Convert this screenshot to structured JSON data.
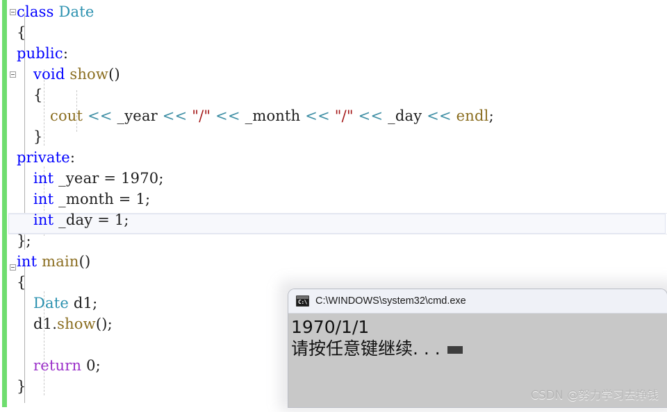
{
  "editor": {
    "language": "C++",
    "change_bar_color": "#6fdd6f",
    "current_line_index": 10,
    "theme": {
      "background": "#ffffff",
      "keyword": "#0000ff",
      "user_type": "#2b91af",
      "identifier": "#8a6d1f",
      "string": "#a31515",
      "operator": "#3f8fa5",
      "control_keyword": "#9b30c9",
      "plain_text": "#1c1c1c",
      "current_line_fill": "#f7f8fc",
      "current_line_border": "#dfe3f0"
    },
    "lines": [
      {
        "indent": 0,
        "tokens": [
          {
            "t": "class",
            "c": "kw"
          },
          {
            "t": " ",
            "c": "plain"
          },
          {
            "t": "Date",
            "c": "type"
          }
        ]
      },
      {
        "indent": 0,
        "tokens": [
          {
            "t": "{",
            "c": "plain"
          }
        ]
      },
      {
        "indent": 0,
        "tokens": [
          {
            "t": "public",
            "c": "kw"
          },
          {
            "t": ":",
            "c": "plain"
          }
        ]
      },
      {
        "indent": 1,
        "tokens": [
          {
            "t": "void",
            "c": "kw"
          },
          {
            "t": " ",
            "c": "plain"
          },
          {
            "t": "show",
            "c": "fn"
          },
          {
            "t": "()",
            "c": "plain"
          }
        ]
      },
      {
        "indent": 1,
        "tokens": [
          {
            "t": "{",
            "c": "plain"
          }
        ]
      },
      {
        "indent": 2,
        "tokens": [
          {
            "t": "cout",
            "c": "fn"
          },
          {
            "t": " ",
            "c": "plain"
          },
          {
            "t": "<<",
            "c": "op"
          },
          {
            "t": " ",
            "c": "plain"
          },
          {
            "t": "_year",
            "c": "plain"
          },
          {
            "t": " ",
            "c": "plain"
          },
          {
            "t": "<<",
            "c": "op"
          },
          {
            "t": " ",
            "c": "plain"
          },
          {
            "t": "\"/\"",
            "c": "str"
          },
          {
            "t": " ",
            "c": "plain"
          },
          {
            "t": "<<",
            "c": "op"
          },
          {
            "t": " ",
            "c": "plain"
          },
          {
            "t": "_month",
            "c": "plain"
          },
          {
            "t": " ",
            "c": "plain"
          },
          {
            "t": "<<",
            "c": "op"
          },
          {
            "t": " ",
            "c": "plain"
          },
          {
            "t": "\"/\"",
            "c": "str"
          },
          {
            "t": " ",
            "c": "plain"
          },
          {
            "t": "<<",
            "c": "op"
          },
          {
            "t": " ",
            "c": "plain"
          },
          {
            "t": "_day",
            "c": "plain"
          },
          {
            "t": " ",
            "c": "plain"
          },
          {
            "t": "<<",
            "c": "op"
          },
          {
            "t": " ",
            "c": "plain"
          },
          {
            "t": "endl",
            "c": "fn"
          },
          {
            "t": ";",
            "c": "plain"
          }
        ]
      },
      {
        "indent": 1,
        "tokens": [
          {
            "t": "}",
            "c": "plain"
          }
        ]
      },
      {
        "indent": 0,
        "tokens": [
          {
            "t": "private",
            "c": "kw"
          },
          {
            "t": ":",
            "c": "plain"
          }
        ]
      },
      {
        "indent": 1,
        "tokens": [
          {
            "t": "int",
            "c": "kw"
          },
          {
            "t": " ",
            "c": "plain"
          },
          {
            "t": "_year",
            "c": "plain"
          },
          {
            "t": " = ",
            "c": "plain"
          },
          {
            "t": "1970",
            "c": "plain"
          },
          {
            "t": ";",
            "c": "plain"
          }
        ]
      },
      {
        "indent": 1,
        "tokens": [
          {
            "t": "int",
            "c": "kw"
          },
          {
            "t": " ",
            "c": "plain"
          },
          {
            "t": "_month",
            "c": "plain"
          },
          {
            "t": " = ",
            "c": "plain"
          },
          {
            "t": "1",
            "c": "plain"
          },
          {
            "t": ";",
            "c": "plain"
          }
        ]
      },
      {
        "indent": 1,
        "tokens": [
          {
            "t": "int",
            "c": "kw"
          },
          {
            "t": " ",
            "c": "plain"
          },
          {
            "t": "_day",
            "c": "plain"
          },
          {
            "t": " = ",
            "c": "plain"
          },
          {
            "t": "1",
            "c": "plain"
          },
          {
            "t": ";",
            "c": "plain"
          }
        ]
      },
      {
        "indent": 0,
        "tokens": [
          {
            "t": "};",
            "c": "plain"
          }
        ]
      },
      {
        "indent": 0,
        "tokens": [
          {
            "t": "int",
            "c": "kw"
          },
          {
            "t": " ",
            "c": "plain"
          },
          {
            "t": "main",
            "c": "fn"
          },
          {
            "t": "()",
            "c": "plain"
          }
        ]
      },
      {
        "indent": 0,
        "tokens": [
          {
            "t": "{",
            "c": "plain"
          }
        ]
      },
      {
        "indent": 1,
        "tokens": [
          {
            "t": "Date",
            "c": "type"
          },
          {
            "t": " ",
            "c": "plain"
          },
          {
            "t": "d1",
            "c": "plain"
          },
          {
            "t": ";",
            "c": "plain"
          }
        ]
      },
      {
        "indent": 1,
        "tokens": [
          {
            "t": "d1",
            "c": "plain"
          },
          {
            "t": ".",
            "c": "plain"
          },
          {
            "t": "show",
            "c": "fn"
          },
          {
            "t": "();",
            "c": "plain"
          }
        ]
      },
      {
        "indent": 1,
        "tokens": []
      },
      {
        "indent": 1,
        "tokens": [
          {
            "t": "return",
            "c": "ctl"
          },
          {
            "t": " ",
            "c": "plain"
          },
          {
            "t": "0",
            "c": "plain"
          },
          {
            "t": ";",
            "c": "plain"
          }
        ]
      },
      {
        "indent": 0,
        "tokens": [
          {
            "t": "}",
            "c": "plain"
          }
        ]
      }
    ],
    "fold_markers": [
      {
        "line": 0,
        "state": "expanded"
      },
      {
        "line": 3,
        "state": "expanded"
      },
      {
        "line": 12,
        "state": "expanded"
      }
    ]
  },
  "console": {
    "title": "C:\\WINDOWS\\system32\\cmd.exe",
    "icon": "cmd-icon",
    "icon_prompt_text": "C:\\",
    "titlebar_color": "#eff1f7",
    "body_color": "#c8c8c8",
    "output_lines": [
      "1970/1/1",
      "请按任意键继续. . ."
    ],
    "cursor_visible": true
  },
  "watermark": {
    "text": "CSDN @努力学习去挣钱"
  }
}
